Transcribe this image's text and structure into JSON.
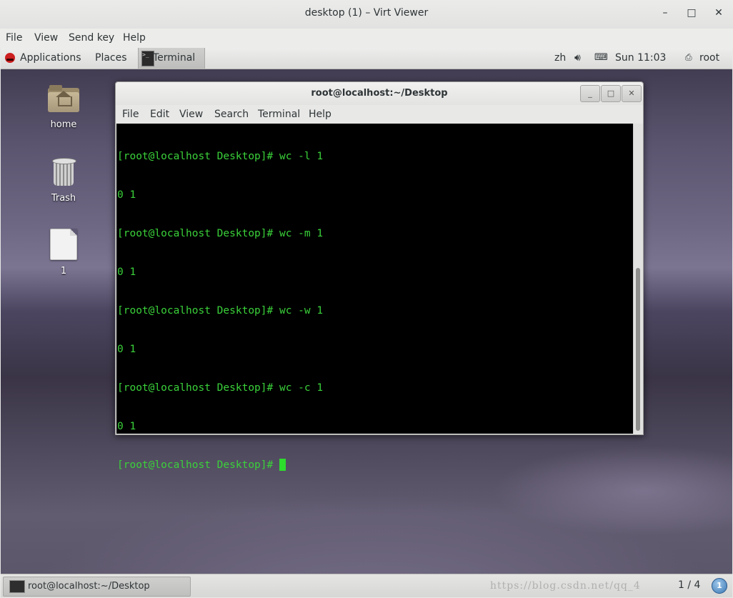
{
  "viewer": {
    "title": "desktop (1) – Virt Viewer",
    "menu": [
      "File",
      "View",
      "Send key",
      "Help"
    ],
    "controls": {
      "minimize": "–",
      "maximize": "□",
      "close": "✕"
    }
  },
  "top_panel": {
    "applications": "Applications",
    "places": "Places",
    "task": "Terminal",
    "lang": "zh",
    "clock": "Sun 11:03",
    "user": "root"
  },
  "desktop_icons": [
    {
      "label": "home",
      "icon": "home-folder-icon"
    },
    {
      "label": "Trash",
      "icon": "trash-icon"
    },
    {
      "label": "1",
      "icon": "file-icon"
    }
  ],
  "terminal": {
    "title": "root@localhost:~/Desktop",
    "menu": [
      "File",
      "Edit",
      "View",
      "Search",
      "Terminal",
      "Help"
    ],
    "lines": [
      "[root@localhost Desktop]# wc -l 1",
      "0 1",
      "[root@localhost Desktop]# wc -m 1",
      "0 1",
      "[root@localhost Desktop]# wc -w 1",
      "0 1",
      "[root@localhost Desktop]# wc -c 1",
      "0 1"
    ],
    "prompt": "[root@localhost Desktop]# ",
    "text_color": "#3ad13a",
    "background": "#000000"
  },
  "bottom_panel": {
    "task": "root@localhost:~/Desktop",
    "watermark": "https://blog.csdn.net/qq_4",
    "workspace": "1 / 4",
    "notification_count": "1"
  }
}
